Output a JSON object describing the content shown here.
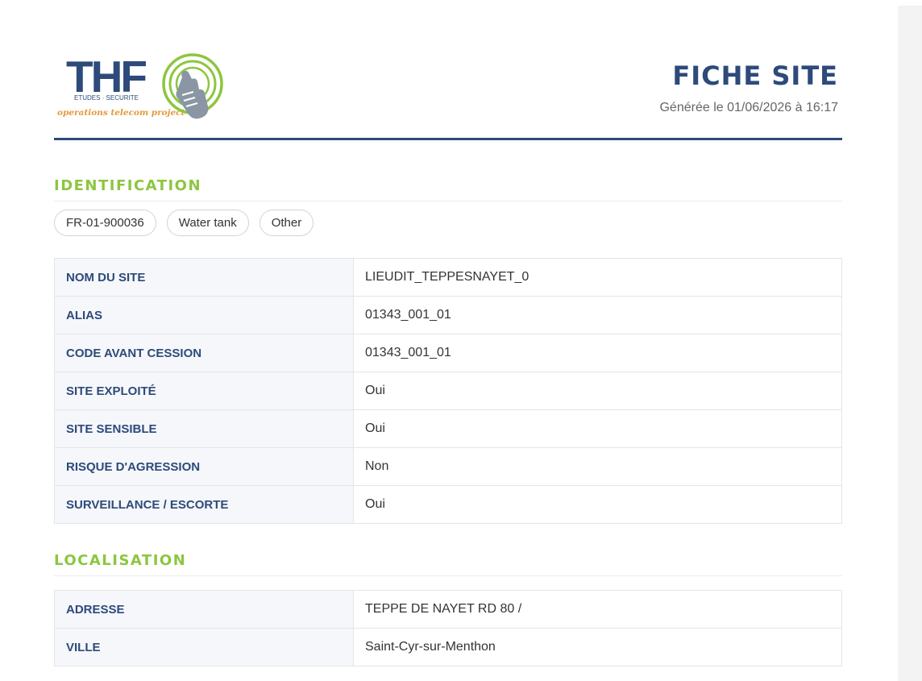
{
  "logo": {
    "brand": "THF",
    "subtitle": "ETUDES · SECURITE",
    "tagline": "operations telecom project",
    "colors": {
      "brand": "#2d4a7a",
      "accent": "#8cc63f",
      "tagline": "#e39a3c",
      "hand": "#8a96a3"
    }
  },
  "header": {
    "title": "FICHE SITE",
    "generated": "Générée le 01/06/2026 à 16:17"
  },
  "identification": {
    "title": "IDENTIFICATION",
    "tags": [
      "FR-01-900036",
      "Water tank",
      "Other"
    ],
    "rows": [
      {
        "label": "NOM DU SITE",
        "value": "LIEUDIT_TEPPESNAYET_0"
      },
      {
        "label": "ALIAS",
        "value": "01343_001_01"
      },
      {
        "label": "CODE AVANT CESSION",
        "value": "01343_001_01"
      },
      {
        "label": "SITE EXPLOITÉ",
        "value": "Oui"
      },
      {
        "label": "SITE SENSIBLE",
        "value": "Oui"
      },
      {
        "label": "RISQUE D'AGRESSION",
        "value": "Non"
      },
      {
        "label": "SURVEILLANCE / ESCORTE",
        "value": "Oui"
      }
    ]
  },
  "localisation": {
    "title": "LOCALISATION",
    "rows": [
      {
        "label": "ADRESSE",
        "value": "TEPPE DE NAYET RD 80 /"
      },
      {
        "label": "VILLE",
        "value": "Saint-Cyr-sur-Menthon"
      }
    ]
  },
  "colors": {
    "primary": "#2d4a7a",
    "section": "#8cc63f",
    "label_bg": "#f5f7fa",
    "border": "#e1e5ea"
  }
}
